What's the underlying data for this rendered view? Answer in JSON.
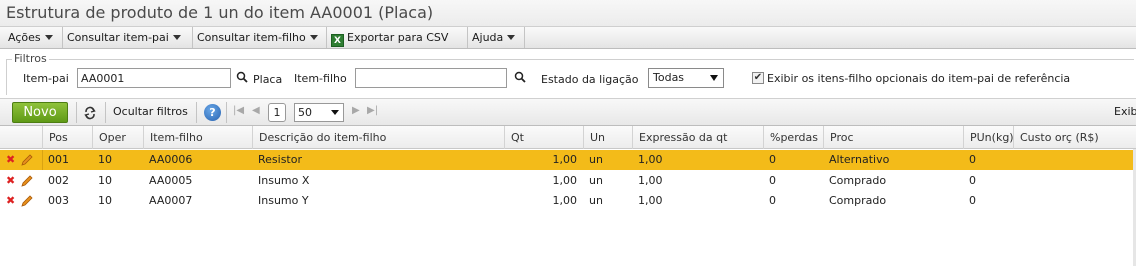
{
  "window": {
    "title": "Estrutura de produto de 1 un do item AA0001 (Placa)"
  },
  "menu": {
    "acoes": "Ações",
    "consultar_pai": "Consultar item-pai",
    "consultar_filho": "Consultar item-filho",
    "exportar": "Exportar para CSV",
    "ajuda": "Ajuda"
  },
  "filters": {
    "legend": "Filtros",
    "item_pai_label": "Item-pai",
    "item_pai_value": "AA0001",
    "item_pai_desc": "Placa",
    "item_filho_label": "Item-filho",
    "item_filho_value": "",
    "estado_label": "Estado da ligação",
    "estado_value": "Todas",
    "checkbox_label": "Exibir os itens-filho opcionais do item-pai de referência",
    "checkbox_checked": true
  },
  "toolbar": {
    "novo": "Novo",
    "ocultar_filtros": "Ocultar filtros",
    "page": "1",
    "page_size": "50",
    "exib": "Exib"
  },
  "table": {
    "columns": [
      "Pos",
      "Oper",
      "Item-filho",
      "Descrição do item-filho",
      "Qt",
      "Un",
      "Expressão da qt",
      "%perdas",
      "Proc",
      "PUn(kg)",
      "Custo orç (R$)"
    ],
    "rows": [
      {
        "pos": "001",
        "oper": "10",
        "item": "AA0006",
        "desc": "Resistor",
        "qt": "1,00",
        "un": "un",
        "expr": "1,00",
        "perdas": "0",
        "proc": "Alternativo",
        "pun": "0",
        "custo": ""
      },
      {
        "pos": "002",
        "oper": "10",
        "item": "AA0005",
        "desc": "Insumo X",
        "qt": "1,00",
        "un": "un",
        "expr": "1,00",
        "perdas": "0",
        "proc": "Comprado",
        "pun": "0",
        "custo": ""
      },
      {
        "pos": "003",
        "oper": "10",
        "item": "AA0007",
        "desc": "Insumo Y",
        "qt": "1,00",
        "un": "un",
        "expr": "1,00",
        "perdas": "0",
        "proc": "Comprado",
        "pun": "0",
        "custo": ""
      }
    ],
    "selected_row": 0
  },
  "colors": {
    "selected_row": "#f3bb19",
    "novo_button": "#6fa824",
    "delete_icon": "#dd2222",
    "edit_icon": "#e8901c"
  }
}
